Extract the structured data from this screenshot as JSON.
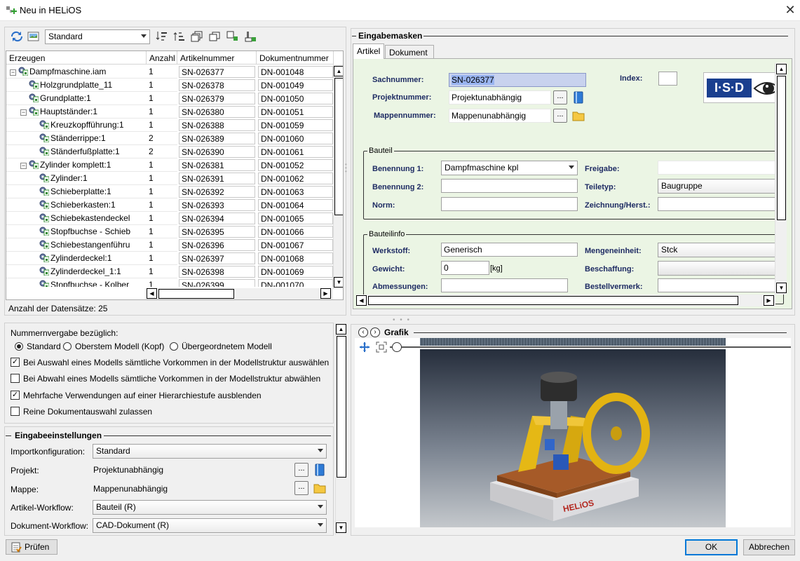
{
  "window": {
    "title": "Neu in HELiOS"
  },
  "toolbar": {
    "config_value": "Standard"
  },
  "grid": {
    "columns": [
      "Erzeugen",
      "Anzahl",
      "Artikelnummer",
      "Dokumentnummer"
    ],
    "rows": [
      {
        "name": "Dampfmaschine.iam",
        "level": 0,
        "expander": "−",
        "count": "1",
        "article": "SN-026377",
        "doc": "DN-001048"
      },
      {
        "name": "Holzgrundplatte_11",
        "level": 1,
        "expander": "",
        "count": "1",
        "article": "SN-026378",
        "doc": "DN-001049"
      },
      {
        "name": "Grundplatte:1",
        "level": 1,
        "expander": "",
        "count": "1",
        "article": "SN-026379",
        "doc": "DN-001050"
      },
      {
        "name": "Hauptständer:1",
        "level": 1,
        "expander": "−",
        "count": "1",
        "article": "SN-026380",
        "doc": "DN-001051"
      },
      {
        "name": "Kreuzkopfführung:1",
        "level": 2,
        "expander": "",
        "count": "1",
        "article": "SN-026388",
        "doc": "DN-001059"
      },
      {
        "name": "Ständerrippe:1",
        "level": 2,
        "expander": "",
        "count": "2",
        "article": "SN-026389",
        "doc": "DN-001060"
      },
      {
        "name": "Ständerfußplatte:1",
        "level": 2,
        "expander": "",
        "count": "2",
        "article": "SN-026390",
        "doc": "DN-001061"
      },
      {
        "name": "Zylinder komplett:1",
        "level": 1,
        "expander": "−",
        "count": "1",
        "article": "SN-026381",
        "doc": "DN-001052"
      },
      {
        "name": "Zylinder:1",
        "level": 2,
        "expander": "",
        "count": "1",
        "article": "SN-026391",
        "doc": "DN-001062"
      },
      {
        "name": "Schieberplatte:1",
        "level": 2,
        "expander": "",
        "count": "1",
        "article": "SN-026392",
        "doc": "DN-001063"
      },
      {
        "name": "Schieberkasten:1",
        "level": 2,
        "expander": "",
        "count": "1",
        "article": "SN-026393",
        "doc": "DN-001064"
      },
      {
        "name": "Schiebekastendeckel",
        "level": 2,
        "expander": "",
        "count": "1",
        "article": "SN-026394",
        "doc": "DN-001065"
      },
      {
        "name": "Stopfbuchse - Schieb",
        "level": 2,
        "expander": "",
        "count": "1",
        "article": "SN-026395",
        "doc": "DN-001066"
      },
      {
        "name": "Schiebestangenführu",
        "level": 2,
        "expander": "",
        "count": "1",
        "article": "SN-026396",
        "doc": "DN-001067"
      },
      {
        "name": "Zylinderdeckel:1",
        "level": 2,
        "expander": "",
        "count": "1",
        "article": "SN-026397",
        "doc": "DN-001068"
      },
      {
        "name": "Zylinderdeckel_1:1",
        "level": 2,
        "expander": "",
        "count": "1",
        "article": "SN-026398",
        "doc": "DN-001069"
      },
      {
        "name": "Stopfbuchse - Kolber",
        "level": 2,
        "expander": "",
        "count": "1",
        "article": "SN-026399",
        "doc": "DN-001070"
      }
    ],
    "record_count": "Anzahl der Datensätze: 25"
  },
  "options": {
    "heading": "Nummernvergabe bezüglich:",
    "radios": [
      "Standard",
      "Oberstem Modell (Kopf)",
      "Übergeordnetem Modell"
    ],
    "checks": [
      {
        "label": "Bei Auswahl eines Modells sämtliche Vorkommen in der Modellstruktur auswählen",
        "mark": "✓"
      },
      {
        "label": "Bei Abwahl eines Modells sämtliche Vorkommen in der Modellstruktur abwählen",
        "mark": ""
      },
      {
        "label": "Mehrfache Verwendungen auf einer Hierarchiestufe ausblenden",
        "mark": "✓"
      },
      {
        "label": "Reine Dokumentauswahl zulassen",
        "mark": ""
      }
    ]
  },
  "settings": {
    "heading": "Eingabeeinstellungen",
    "import_label": "Importkonfiguration:",
    "import_value": "Standard",
    "project_label": "Projekt:",
    "project_value": "Projektunabhängig",
    "folder_label": "Mappe:",
    "folder_value": "Mappenunabhängig",
    "article_wf_label": "Artikel-Workflow:",
    "article_wf_value": "Bauteil (R)",
    "doc_wf_label": "Dokument-Workflow:",
    "doc_wf_value": "CAD-Dokument (R)"
  },
  "masks": {
    "heading": "Eingabemasken",
    "tabs": [
      "Artikel",
      "Dokument"
    ],
    "sachnummer_label": "Sachnummer:",
    "sachnummer_value": "SN-026377",
    "index_label": "Index:",
    "projektnummer_label": "Projektnummer:",
    "projektnummer_value": "Projektunabhängig",
    "mappennummer_label": "Mappennummer:",
    "mappennummer_value": "Mappenunabhängig",
    "logo_text": "I·S·D",
    "bauteil_heading": "Bauteil",
    "benennung1_label": "Benennung 1:",
    "benennung1_value": "Dampfmaschine kpl",
    "freigabe_label": "Freigabe:",
    "benennung2_label": "Benennung 2:",
    "teiletyp_label": "Teiletyp:",
    "teiletyp_value": "Baugruppe",
    "norm_label": "Norm:",
    "zeichnung_label": "Zeichnung/Herst.:",
    "bauteilinfo_heading": "Bauteilinfo",
    "werkstoff_label": "Werkstoff:",
    "werkstoff_value": "Generisch",
    "mengeneinheit_label": "Mengeneinheit:",
    "mengeneinheit_value": "Stck",
    "gewicht_label": "Gewicht:",
    "gewicht_value": "0",
    "gewicht_unit": "[kg]",
    "beschaffung_label": "Beschaffung:",
    "abmessungen_label": "Abmessungen:",
    "bestellvermerk_label": "Bestellvermerk:"
  },
  "graphic": {
    "heading": "Grafik",
    "brand_text": "HELiOS"
  },
  "footer": {
    "check_button": "Prüfen",
    "ok_button": "OK",
    "cancel_button": "Abbrechen"
  },
  "colors": {
    "form_bg": "#ebf5e4",
    "label_blue": "#1e2b63",
    "selection": "#99b4f0"
  }
}
